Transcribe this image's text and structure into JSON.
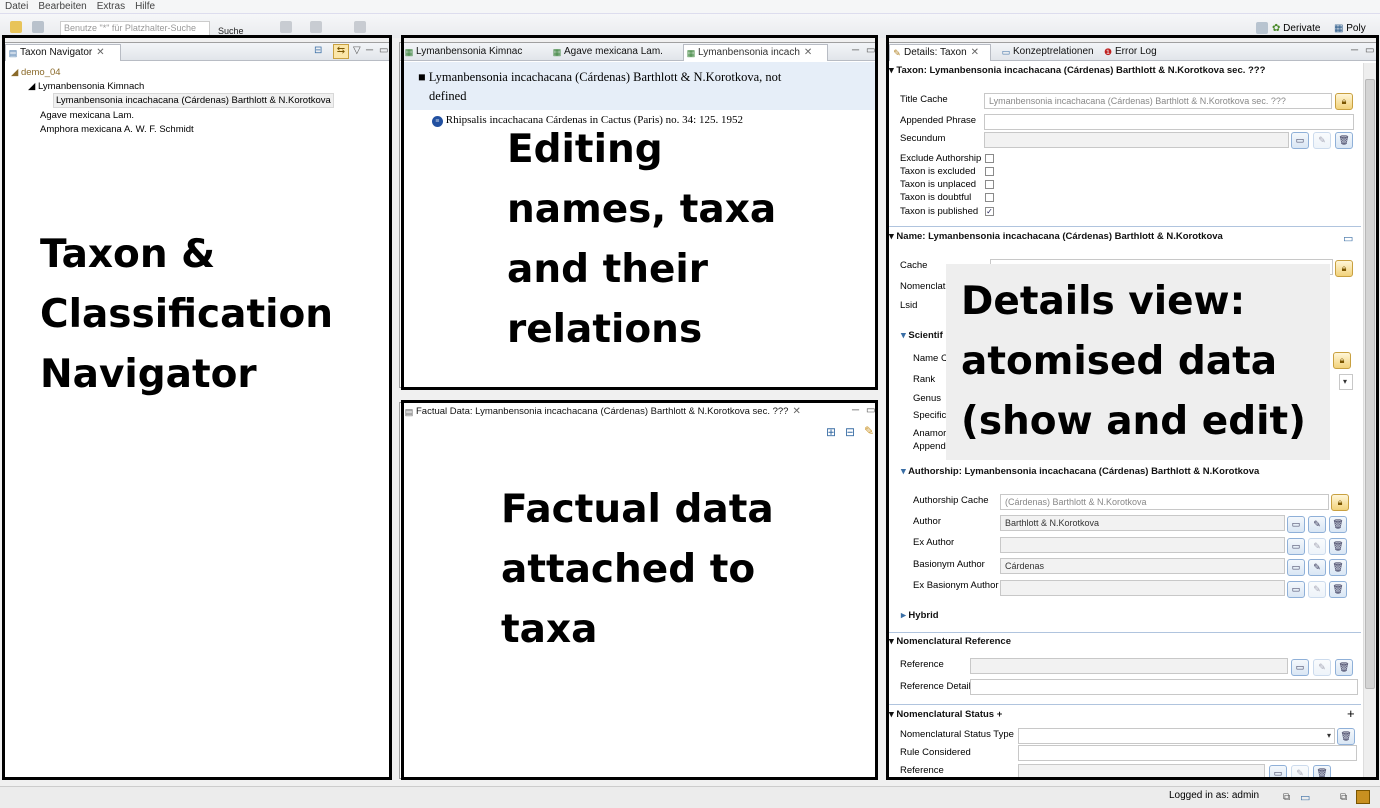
{
  "menu": {
    "items": [
      "Datei",
      "Bearbeiten",
      "Extras",
      "Hilfe"
    ]
  },
  "toolbar": {
    "search_placeholder": "Benutze \"*\" für Platzhalter-Suche",
    "search_label": "Suche",
    "right_links": [
      "Derivate",
      "Poly"
    ]
  },
  "navigator": {
    "tab_title": "Taxon Navigator",
    "tree": [
      {
        "label": "demo_04",
        "level": 0
      },
      {
        "label": "Lymanbensonia Kimnach",
        "level": 1
      },
      {
        "label": "Lymanbensonia incachacana (Cárdenas) Barthlott & N.Korotkova",
        "level": 2,
        "selected": true
      },
      {
        "label": "Agave mexicana Lam.",
        "level": 1
      },
      {
        "label": "Amphora mexicana A. W. F. Schmidt",
        "level": 1
      }
    ]
  },
  "editor": {
    "tabs": [
      "Lymanbensonia Kimnac",
      "Agave mexicana Lam.",
      "Lymanbensonia incach"
    ],
    "accepted_name_line1": "Lymanbensonia incachacana (Cárdenas) Barthlott & N.Korotkova, not",
    "accepted_name_line2": "defined",
    "synonym": "Rhipsalis incachacana Cárdenas in Cactus (Paris) no. 34: 125. 1952"
  },
  "factual": {
    "tab_title": "Factual Data: Lymanbensonia incachacana (Cárdenas) Barthlott & N.Korotkova sec. ???"
  },
  "details": {
    "tabs": [
      "Details: Taxon",
      "Konzeptrelationen",
      "Error Log"
    ],
    "taxon_section": "Taxon: Lymanbensonia incachacana (Cárdenas) Barthlott & N.Korotkova sec. ???",
    "title_cache_label": "Title Cache",
    "title_cache_value": "Lymanbensonia incachacana (Cárdenas) Barthlott & N.Korotkova sec. ???",
    "appended_phrase_label": "Appended Phrase",
    "secundum_label": "Secundum",
    "checkboxes": [
      {
        "label": "Exclude Authorship",
        "checked": false
      },
      {
        "label": "Taxon is excluded",
        "checked": false
      },
      {
        "label": "Taxon is unplaced",
        "checked": false
      },
      {
        "label": "Taxon is doubtful",
        "checked": false
      },
      {
        "label": "Taxon is published",
        "checked": true
      }
    ],
    "name_section": "Name: Lymanbensonia incachacana (Cárdenas) Barthlott & N.Korotkova",
    "cache_label": "Cache",
    "nomenclat_label": "Nomenclat",
    "lsid_label": "Lsid",
    "scientific_label": "Scientif",
    "name_c_label": "Name C",
    "rank_label": "Rank",
    "genus_label": "Genus",
    "specific_label": "Specific",
    "anamor_label": "Anamor",
    "append_label": "Append",
    "authorship_section": "Authorship: Lymanbensonia incachacana (Cárdenas) Barthlott & N.Korotkova",
    "authorship_cache_label": "Authorship Cache",
    "authorship_cache_value": "(Cárdenas) Barthlott & N.Korotkova",
    "author_label": "Author",
    "author_value": "Barthlott & N.Korotkova",
    "ex_author_label": "Ex Author",
    "basionym_author_label": "Basionym Author",
    "basionym_author_value": "Cárdenas",
    "ex_basionym_author_label": "Ex Basionym Author",
    "hybrid_label": "Hybrid",
    "nom_ref_section": "Nomenclatural Reference",
    "reference_label": "Reference",
    "reference_detail_label": "Reference Detail",
    "nom_status_section": "Nomenclatural Status +",
    "nom_status_type_label": "Nomenclatural Status Type",
    "rule_considered_label": "Rule Considered",
    "reference2_label": "Reference"
  },
  "annotations": {
    "navigator_line1": "Taxon &",
    "navigator_line2": "Classification",
    "navigator_line3": "Navigator",
    "editor_line1": "Editing",
    "editor_line2": "names, taxa",
    "editor_line3": "and their",
    "editor_line4": "relations",
    "factual_line1": "Factual data",
    "factual_line2": "attached to",
    "factual_line3": "taxa",
    "details_line1": "Details view:",
    "details_line2": "atomised data",
    "details_line3": "(show and edit)"
  },
  "status": {
    "logged_in": "Logged in as: admin"
  }
}
